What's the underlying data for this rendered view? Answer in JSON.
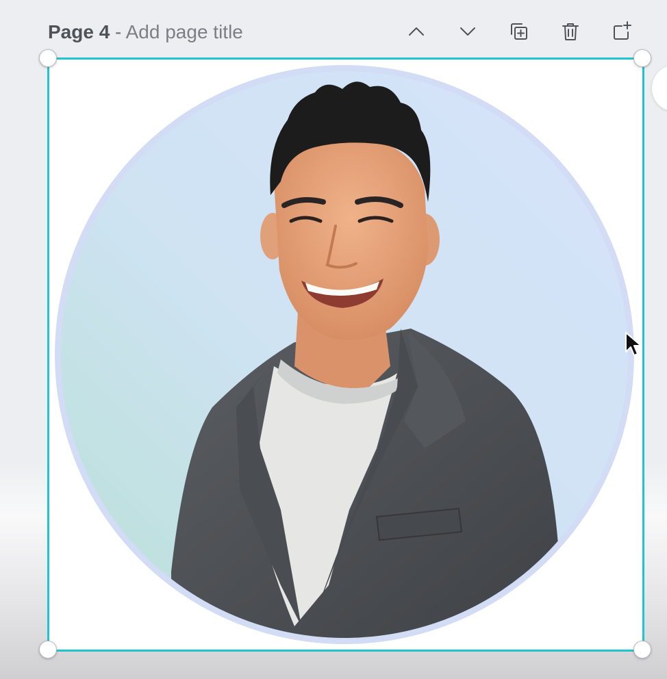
{
  "header": {
    "page_number": "Page 4",
    "separator": " - ",
    "page_title_placeholder": "Add page title"
  },
  "toolbar": {
    "move_up_icon": "chevron-up-icon",
    "move_down_icon": "chevron-down-icon",
    "duplicate_icon": "duplicate-page-icon",
    "delete_icon": "trash-icon",
    "add_page_icon": "add-page-icon"
  },
  "canvas": {
    "element": "circular-portrait-photo",
    "selected": true
  },
  "colors": {
    "selection": "#1fc4cf",
    "circle_ring": "#cfdcf6",
    "circle_fill_light": "#d9e7f8",
    "circle_fill_teal": "#bfe3dd",
    "icon": "#4d5258",
    "title": "#6b6f75"
  }
}
